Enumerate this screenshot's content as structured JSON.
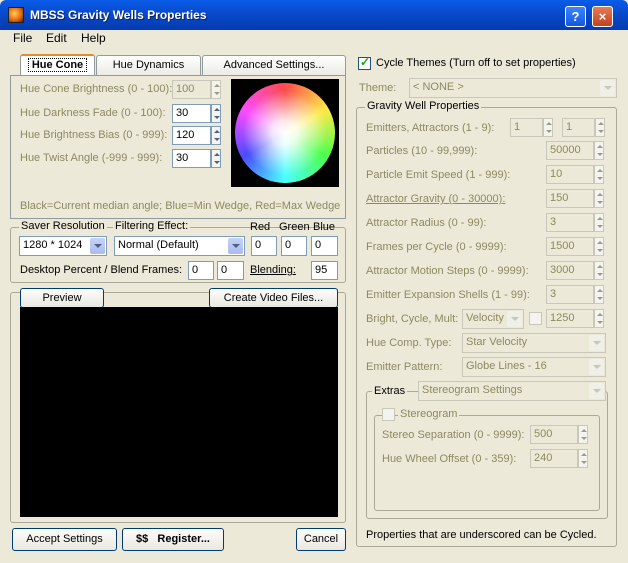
{
  "window": {
    "title": "MBSS Gravity Wells Properties",
    "help_glyph": "?",
    "close_glyph": "×"
  },
  "menu": [
    "File",
    "Edit",
    "Help"
  ],
  "tabs": [
    {
      "label": "Hue Cone",
      "active": true
    },
    {
      "label": "Hue Dynamics"
    },
    {
      "label": "Advanced Settings..."
    }
  ],
  "hue_cone": {
    "fields": [
      {
        "label": "Hue Cone Brightness (0 - 100):",
        "value": "100"
      },
      {
        "label": "Hue Darkness Fade (0 - 100):",
        "value": "30"
      },
      {
        "label": "Hue Brightness Bias (0 - 999):",
        "value": "120"
      },
      {
        "label": "Hue Twist Angle (-999 - 999):",
        "value": "30"
      }
    ],
    "legend": "Black=Current median angle; Blue=Min Wedge, Red=Max Wedge"
  },
  "saver": {
    "resolution_label": "Saver Resolution",
    "resolution_value": "1280 * 1024",
    "filter_label": "Filtering Effect:",
    "filter_value": "Normal (Default)",
    "red_label": "Red",
    "green_label": "Green",
    "blue_label": "Blue",
    "red_value": "0",
    "green_value": "0",
    "blue_value": "0",
    "desktop_label": "Desktop Percent / Blend Frames:",
    "desktop_value": "0",
    "blend_frames_value": "0",
    "blending_label": "Blending:",
    "blending_value": "95"
  },
  "preview": {
    "preview_button": "Preview",
    "video_button": "Create Video Files..."
  },
  "bottom": {
    "accept": "Accept Settings",
    "register": "$$   Register...",
    "cancel": "Cancel"
  },
  "right": {
    "cycle_label": "Cycle Themes (Turn off to set properties)",
    "cycle_checked": true,
    "theme_label": "Theme:",
    "theme_value": "< NONE >",
    "group_title": "Gravity Well Properties",
    "emitters_label": "Emitters, Attractors (1 - 9):",
    "emitters_value": "1",
    "attractors_value": "1",
    "rows": [
      {
        "label": "Particles (10 - 99,999):",
        "value": "50000"
      },
      {
        "label": "Particle Emit Speed (1 - 999):",
        "value": "10"
      },
      {
        "label": "Attractor Gravity (0 - 30000):",
        "value": "150",
        "underline": true
      },
      {
        "label": "Attractor Radius (0 - 99):",
        "value": "3"
      },
      {
        "label": "Frames per Cycle (0 - 9999):",
        "value": "1500"
      },
      {
        "label": "Attractor Motion Steps (0 - 9999):",
        "value": "3000"
      },
      {
        "label": "Emitter Expansion Shells (1 - 99):",
        "value": "3"
      }
    ],
    "bright_label": "Bright, Cycle, Mult:",
    "bright_value": "Velocity",
    "bright_mult": "1250",
    "hue_comp_label": "Hue Comp. Type:",
    "hue_comp_value": "Star Velocity",
    "emitter_pattern_label": "Emitter Pattern:",
    "emitter_pattern_value": "Globe Lines - 16",
    "extras_label": "Extras",
    "extras_value": "Stereogram Settings",
    "stereogram_label": "Stereogram",
    "stereo_sep_label": "Stereo Separation (0 - 9999):",
    "stereo_sep_value": "500",
    "hue_wheel_label": "Hue Wheel Offset (0 - 359):",
    "hue_wheel_value": "240",
    "footer": "Properties that are underscored can be Cycled."
  },
  "colors": {
    "title_bar": "#0a5ce8",
    "window_bg": "#ece9d8",
    "accent_tab": "#e68b2c"
  }
}
